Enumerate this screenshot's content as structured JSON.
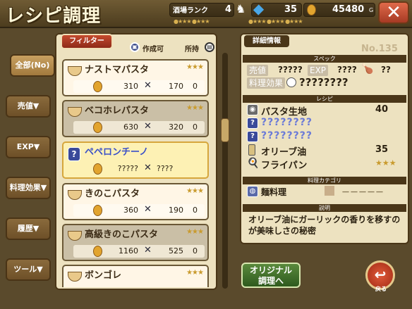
{
  "header": {
    "title": "レシピ調理",
    "rank_label": "酒場ランク",
    "rank_value": "4",
    "gem_value": "35",
    "gold_value": "45480",
    "gold_unit": "G",
    "close_label": "✕"
  },
  "sidebar": {
    "tabs": [
      {
        "label": "全部(No)"
      },
      {
        "label": "売値▼"
      },
      {
        "label": "EXP▼"
      },
      {
        "label": "料理効果▼"
      },
      {
        "label": "履歴▼"
      },
      {
        "label": "ツール▼"
      }
    ]
  },
  "list": {
    "filter_label": "フィルター",
    "legend_craftable": "作成可",
    "legend_owned": "所持",
    "items": [
      {
        "name": "ナストマパスタ",
        "price": "310",
        "exp": "170",
        "owned": "0",
        "stars": "★★★"
      },
      {
        "name": "ベコホレパスタ",
        "price": "630",
        "exp": "320",
        "owned": "0",
        "stars": "★★★"
      },
      {
        "name": "ペペロンチーノ",
        "price": "?????",
        "exp": "????",
        "owned": "",
        "stars": ""
      },
      {
        "name": "きのこパスタ",
        "price": "360",
        "exp": "190",
        "owned": "0",
        "stars": "★★★"
      },
      {
        "name": "高級きのこパスタ",
        "price": "1160",
        "exp": "525",
        "owned": "0",
        "stars": "★★★"
      },
      {
        "name": "ボンゴレ",
        "price": "",
        "exp": "",
        "owned": "",
        "stars": "★★★"
      }
    ]
  },
  "detail": {
    "tab_label": "詳細情報",
    "recipe_no": "No.135",
    "spec_label": "スペック",
    "price_label": "売値",
    "price_value": "?????",
    "exp_label": "EXP",
    "exp_value": "????",
    "exp_extra": "??",
    "effect_label": "料理効果",
    "effect_value": "????????",
    "recipe_label": "レシピ",
    "ingredients": [
      {
        "name": "パスタ生地",
        "qty": "40"
      },
      {
        "name": "????????",
        "qty": ""
      },
      {
        "name": "????????",
        "qty": ""
      },
      {
        "name": "オリーブ油",
        "qty": "35"
      },
      {
        "name": "フライパン",
        "qty": "★★★"
      }
    ],
    "category_label": "料理カテゴリ",
    "category_value": "麺料理",
    "category_extra": "－－－－－",
    "desc_label": "説明",
    "description": "オリーブ油にガーリックの香りを移すのが美味しさの秘密"
  },
  "actions": {
    "original_label_1": "オリジナル",
    "original_label_2": "調理へ",
    "back_label": "戻る"
  },
  "colors": {
    "accent": "#c44a2e",
    "panel": "#ede2c0",
    "frame": "#4a3618"
  }
}
